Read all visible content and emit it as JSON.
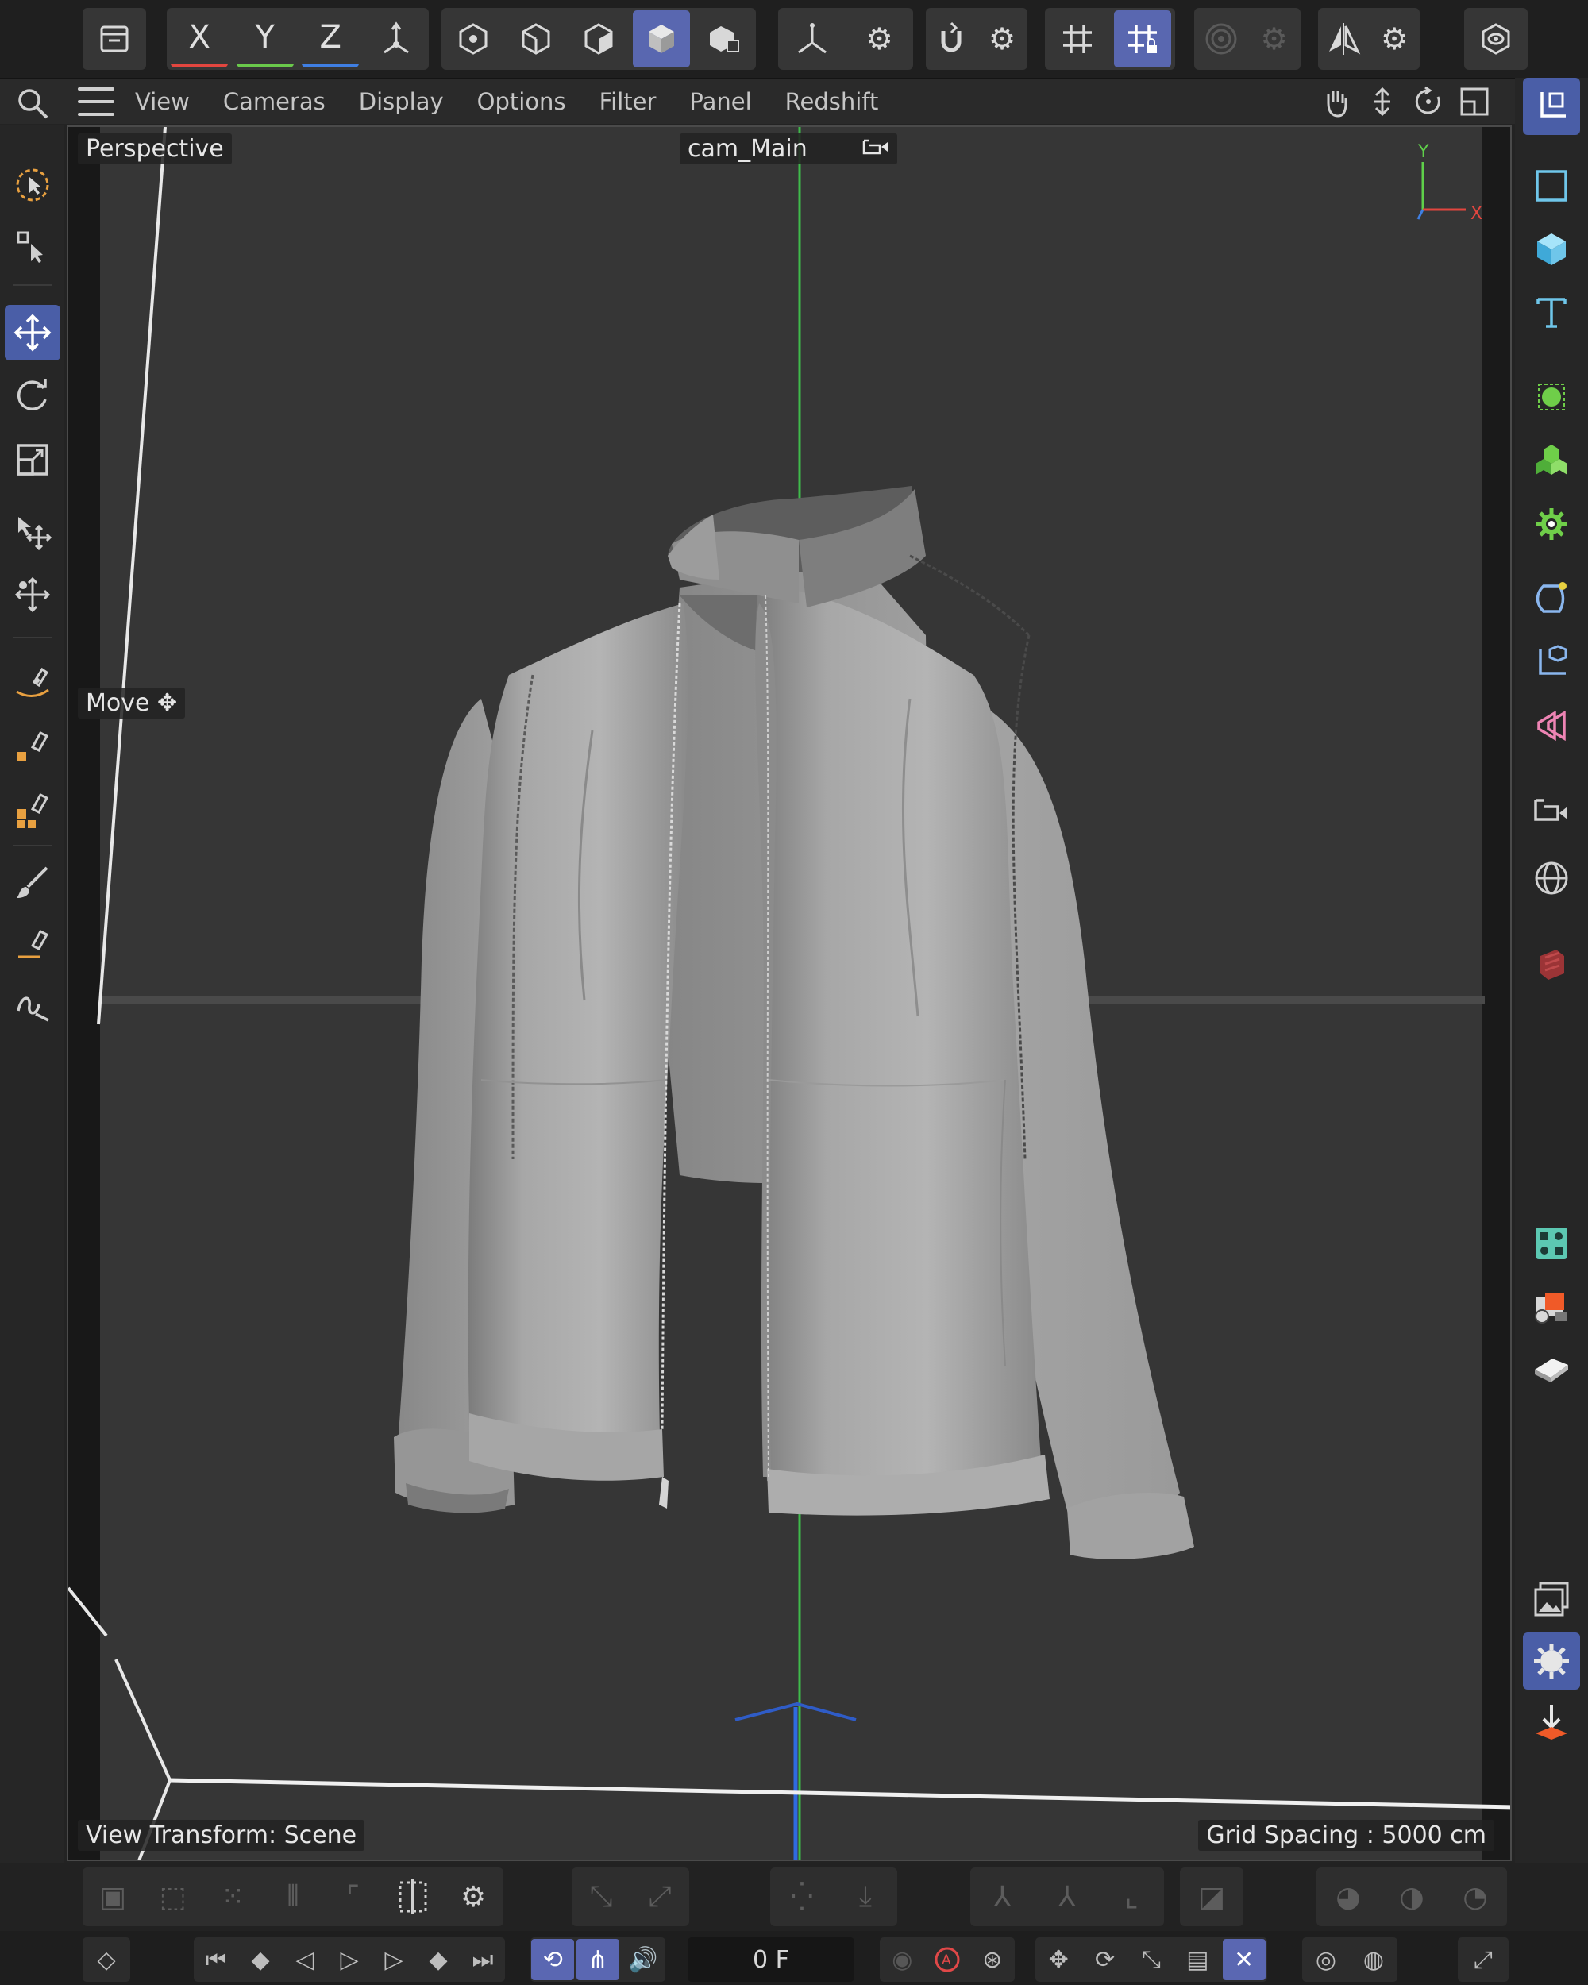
{
  "toolbar": {
    "axis_x": "X",
    "axis_y": "Y",
    "axis_z": "Z"
  },
  "menu": {
    "items": [
      "View",
      "Cameras",
      "Display",
      "Options",
      "Filter",
      "Panel",
      "Redshift"
    ]
  },
  "viewport": {
    "view_name": "Perspective",
    "camera_name": "cam_Main",
    "active_tool_hint": "Move",
    "view_transform": "View Transform: Scene",
    "grid_spacing": "Grid Spacing : 5000 cm",
    "gizmo_y": "Y",
    "gizmo_x": "X"
  },
  "timeline": {
    "current_frame": "0 F"
  },
  "colors": {
    "accent": "#5967b0",
    "axis_x": "#e2463f",
    "axis_y": "#6ac94b",
    "axis_z": "#3f7fe3",
    "viewport_bg": "#363636",
    "cloth": "#a9a9a9"
  },
  "icons": {
    "top": [
      "undo-history-icon",
      "axis-x-lock",
      "axis-y-lock",
      "axis-z-lock",
      "coordinate-system-icon",
      "points-mode-icon",
      "edges-mode-icon",
      "polygons-mode-icon",
      "model-mode-icon",
      "texture-mode-icon",
      "axis-mode-icon",
      "settings-icon",
      "snap-icon",
      "settings-icon",
      "grid-snap-icon",
      "workplane-lock-icon",
      "soft-selection-icon",
      "settings-icon",
      "symmetry-icon",
      "settings-icon",
      "view-settings-icon"
    ],
    "left": [
      "live-selection-icon",
      "selection-tools-icon",
      "move-icon",
      "rotate-icon",
      "scale-icon",
      "transform-icon",
      "multi-transform-icon",
      "spline-pen-icon",
      "spline-point-icon",
      "spline-group-icon",
      "brush-icon",
      "spline-smooth-icon",
      "spline-sketch-icon"
    ],
    "right": [
      "coordinate-space-icon",
      "rectangle-primitive-icon",
      "cube-primitive-icon",
      "text-object-icon",
      "subdivision-generator-icon",
      "cloner-icon",
      "effector-icon",
      "deformer-icon",
      "field-icon",
      "simulation-icon",
      "camera-icon",
      "sky-environment-icon",
      "redshift-object-icon",
      "object-manager-icon",
      "material-manager-icon",
      "floor-icon",
      "render-view-icon",
      "render-settings-icon",
      "render-output-icon"
    ]
  }
}
